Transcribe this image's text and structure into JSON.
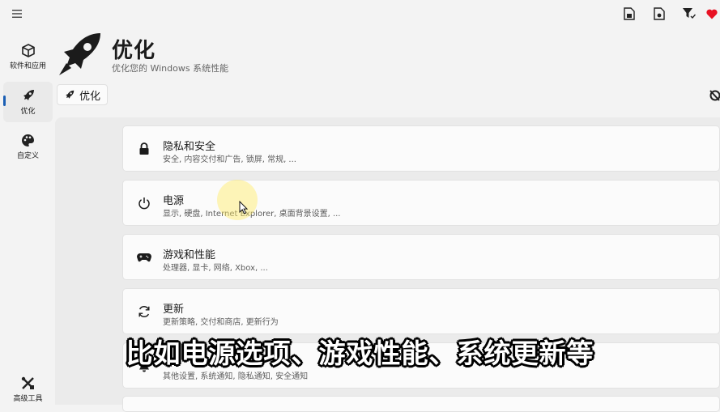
{
  "nav": {
    "apps_label": "软件和应用",
    "optimize_label": "优化",
    "customize_label": "自定义",
    "advanced_label": "高级工具"
  },
  "header": {
    "title": "优化",
    "subtitle": "优化您的 Windows 系统性能",
    "crumb_label": "优化"
  },
  "cards": [
    {
      "title": "隐私和安全",
      "desc": "安全, 内容交付和广告, 锁屏, 常规, ..."
    },
    {
      "title": "电源",
      "desc": "显示, 硬盘, Internet Explorer, 桌面背景设置, ..."
    },
    {
      "title": "游戏和性能",
      "desc": "处理器, 显卡, 网络, Xbox, ..."
    },
    {
      "title": "更新",
      "desc": "更新策略, 交付和商店, 更新行为"
    },
    {
      "title": "",
      "desc": "其他设置, 系统通知, 隐私通知, 安全通知"
    }
  ],
  "caption": "比如电源选项、游戏性能、系统更新等",
  "colors": {
    "accent": "#1b5fb4",
    "heart": "#e81123"
  }
}
